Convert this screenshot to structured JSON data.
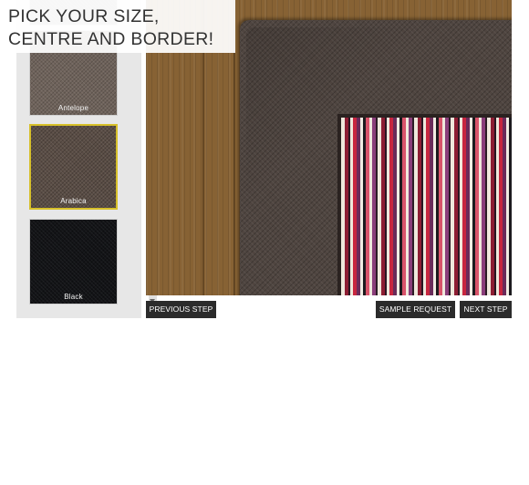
{
  "title": {
    "line1": "PICK YOUR SIZE,",
    "line2": "CENTRE AND BORDER!"
  },
  "swatches": [
    {
      "label": "",
      "selected": false
    },
    {
      "label": "Antelope",
      "selected": false
    },
    {
      "label": "Arabica",
      "selected": true
    },
    {
      "label": "Black",
      "selected": false
    }
  ],
  "buttons": {
    "previous": "PREVIOUS STEP",
    "sample": "SAMPLE REQUEST",
    "next": "NEXT STEP"
  },
  "colors": {
    "selected_border": "#d7c02a",
    "button_bg": "#2b2b2b"
  }
}
